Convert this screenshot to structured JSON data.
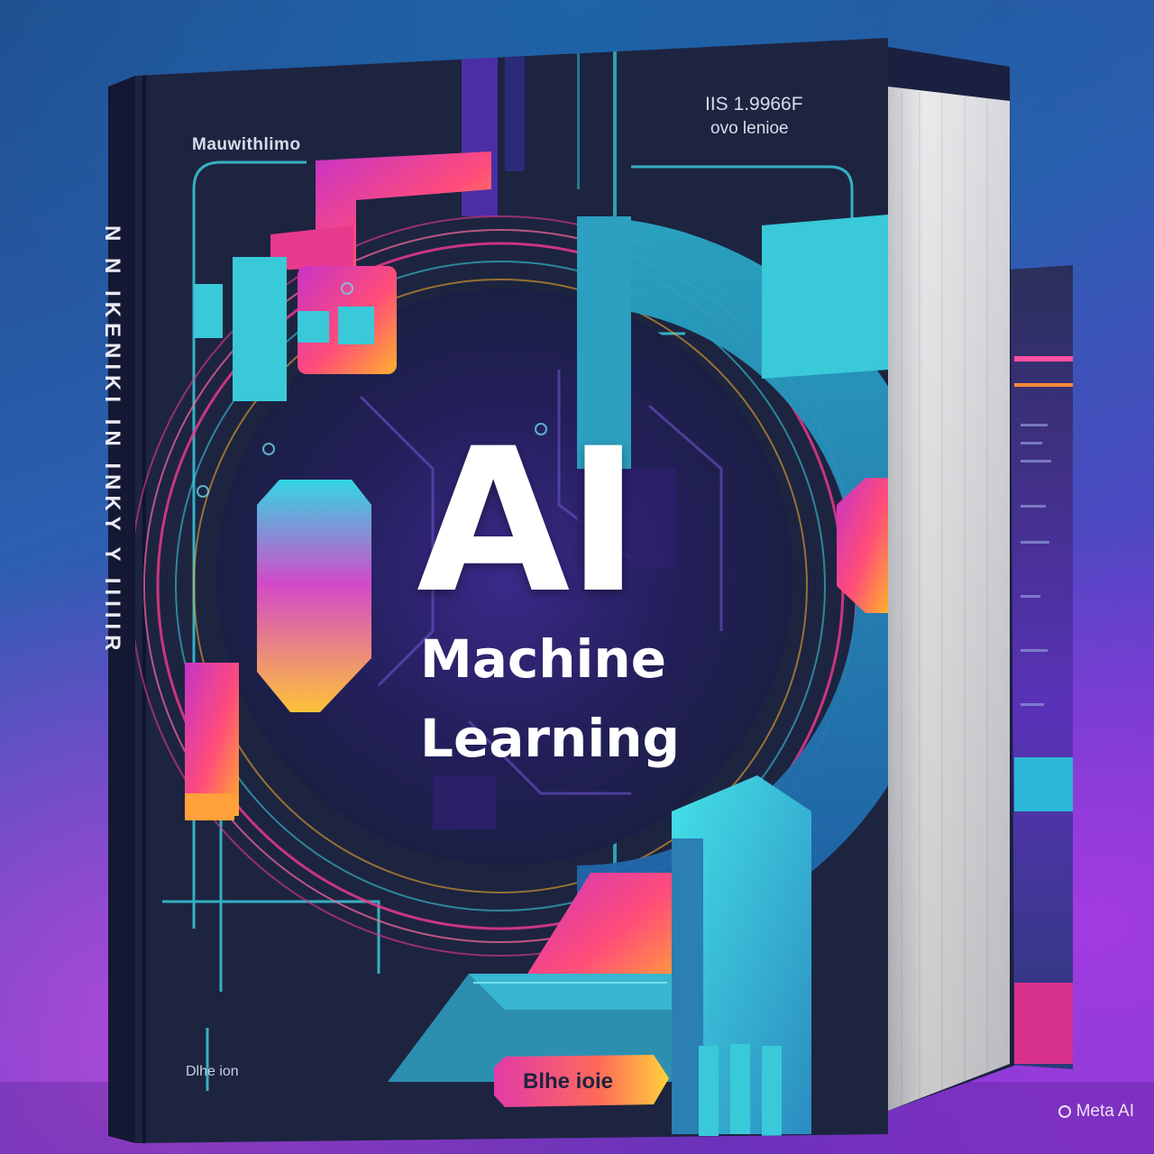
{
  "cover": {
    "title_main": "AI",
    "title_line1": "Machine",
    "title_line2": "Learning",
    "top_left_text": "Mauwithlimo",
    "top_right_line1": "IIS 1.9966F",
    "top_right_line2": "ovo lenioe",
    "bottom_left_text": "Dlhe ion",
    "badge_text": "Blhe ioie"
  },
  "spine": {
    "text": "N N  IKENIKI IN  INKY Y IIIIIR"
  },
  "watermark": {
    "label": "Meta AI"
  },
  "palette": {
    "navy": "#1d2440",
    "cyan": "#39c9d9",
    "teal": "#2d8fb0",
    "magenta": "#e83a8c",
    "orange": "#f79a38",
    "purple": "#5a2bb8",
    "page_white": "#f1f1f3"
  }
}
